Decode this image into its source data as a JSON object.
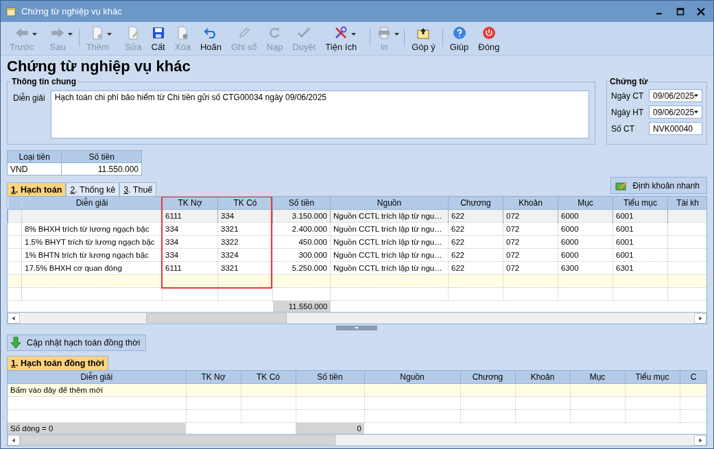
{
  "window": {
    "title": "Chứng từ nghiệp vụ khác"
  },
  "toolbar": [
    {
      "label": "Trước",
      "kind": "back",
      "disabled": true,
      "dropdown": true,
      "separator_before": false
    },
    {
      "label": "Sau",
      "kind": "forward",
      "disabled": true,
      "dropdown": true,
      "separator_before": false
    },
    {
      "label": "Thêm",
      "kind": "add",
      "disabled": true,
      "dropdown": true,
      "separator_before": true
    },
    {
      "label": "Sửa",
      "kind": "edit",
      "disabled": true,
      "dropdown": false,
      "separator_before": false
    },
    {
      "label": "Cất",
      "kind": "save",
      "disabled": false,
      "dropdown": false,
      "separator_before": false
    },
    {
      "label": "Xóa",
      "kind": "delete",
      "disabled": true,
      "dropdown": false,
      "separator_before": false
    },
    {
      "label": "Hoãn",
      "kind": "undo",
      "disabled": false,
      "dropdown": false,
      "separator_before": false
    },
    {
      "label": "Ghi sổ",
      "kind": "post",
      "disabled": true,
      "dropdown": false,
      "separator_before": false
    },
    {
      "label": "Nạp",
      "kind": "reload",
      "disabled": true,
      "dropdown": false,
      "separator_before": false
    },
    {
      "label": "Duyệt",
      "kind": "approve",
      "disabled": true,
      "dropdown": false,
      "separator_before": false
    },
    {
      "label": "Tiện ích",
      "kind": "tools",
      "disabled": false,
      "dropdown": true,
      "separator_before": false
    },
    {
      "label": "In",
      "kind": "print",
      "disabled": true,
      "dropdown": true,
      "separator_before": true
    },
    {
      "label": "Góp ý",
      "kind": "feedback",
      "disabled": false,
      "dropdown": false,
      "separator_before": true
    },
    {
      "label": "Giúp",
      "kind": "help",
      "disabled": false,
      "dropdown": false,
      "separator_before": true
    },
    {
      "label": "Đóng",
      "kind": "close",
      "disabled": false,
      "dropdown": false,
      "separator_before": false
    }
  ],
  "heading": "Chứng từ nghiệp vụ khác",
  "general": {
    "title": "Thông tin chung",
    "description_label": "Diễn giải",
    "description": "Hạch toán chi phí bảo hiểm từ Chi tiền gửi số CTG00034 ngày 09/06/2025"
  },
  "voucher": {
    "title": "Chứng từ",
    "fields": [
      {
        "label": "Ngày CT",
        "value": "09/06/2025",
        "kind": "date"
      },
      {
        "label": "Ngày HT",
        "value": "09/06/2025",
        "kind": "date"
      },
      {
        "label": "Số CT",
        "value": "NVK00040",
        "kind": "text"
      }
    ]
  },
  "currency": {
    "columns": [
      "Loại tiền",
      "Số tiền"
    ],
    "row": [
      "VND",
      "11.550.000"
    ]
  },
  "tabs": [
    {
      "label": "1. Hạch toán",
      "selected": true
    },
    {
      "label": "2. Thống kê",
      "selected": false
    },
    {
      "label": "3. Thuế",
      "selected": false
    }
  ],
  "quick_button": "Định khoản nhanh",
  "grid": {
    "columns": [
      {
        "label": "Diễn giải"
      },
      {
        "label": "TK Nợ"
      },
      {
        "label": "TK Có"
      },
      {
        "label": "Số tiền"
      },
      {
        "label": "Nguồn"
      },
      {
        "label": "Chương"
      },
      {
        "label": "Khoản"
      },
      {
        "label": "Mục"
      },
      {
        "label": "Tiểu mục"
      },
      {
        "label": "Tài kh"
      }
    ],
    "rows": [
      {
        "selected": true,
        "cells": [
          "",
          "6111",
          "334",
          "3.150.000",
          "Nguồn CCTL trích lập từ ngu…",
          "622",
          "072",
          "6000",
          "6001",
          ""
        ]
      },
      {
        "selected": false,
        "cells": [
          "8% BHXH trích từ lương ngạch bậc",
          "334",
          "3321",
          "2.400.000",
          "Nguồn CCTL trích lập từ ngu…",
          "622",
          "072",
          "6000",
          "6001",
          ""
        ]
      },
      {
        "selected": false,
        "cells": [
          "1.5% BHYT trích từ lương ngạch bậc",
          "334",
          "3322",
          "450.000",
          "Nguồn CCTL trích lập từ ngu…",
          "622",
          "072",
          "6000",
          "6001",
          ""
        ]
      },
      {
        "selected": false,
        "cells": [
          "1% BHTN trích từ lương ngạch bậc",
          "334",
          "3324",
          "300.000",
          "Nguồn CCTL trích lập từ ngu…",
          "622",
          "072",
          "6000",
          "6001",
          ""
        ]
      },
      {
        "selected": false,
        "cells": [
          "17.5% BHXH cơ quan đóng",
          "6111",
          "3321",
          "5.250.000",
          "Nguồn CCTL trích lập từ ngu…",
          "622",
          "072",
          "6300",
          "6301",
          ""
        ]
      }
    ],
    "total": "11.550.000"
  },
  "update_button": "Cập nhật hạch toán đồng thời",
  "sub_tabs": [
    {
      "label": "1. Hạch toán đồng thời",
      "selected": true
    }
  ],
  "sub_grid": {
    "columns": [
      {
        "label": "Diễn giải"
      },
      {
        "label": "TK Nợ"
      },
      {
        "label": "TK Có"
      },
      {
        "label": "Số tiền"
      },
      {
        "label": "Nguồn"
      },
      {
        "label": "Chương"
      },
      {
        "label": "Khoản"
      },
      {
        "label": "Mục"
      },
      {
        "label": "Tiểu mục"
      },
      {
        "label": "C"
      }
    ],
    "new_row_prompt": "Bấm vào đây để thêm mới",
    "row_count": "Số dòng = 0",
    "total": "0"
  }
}
